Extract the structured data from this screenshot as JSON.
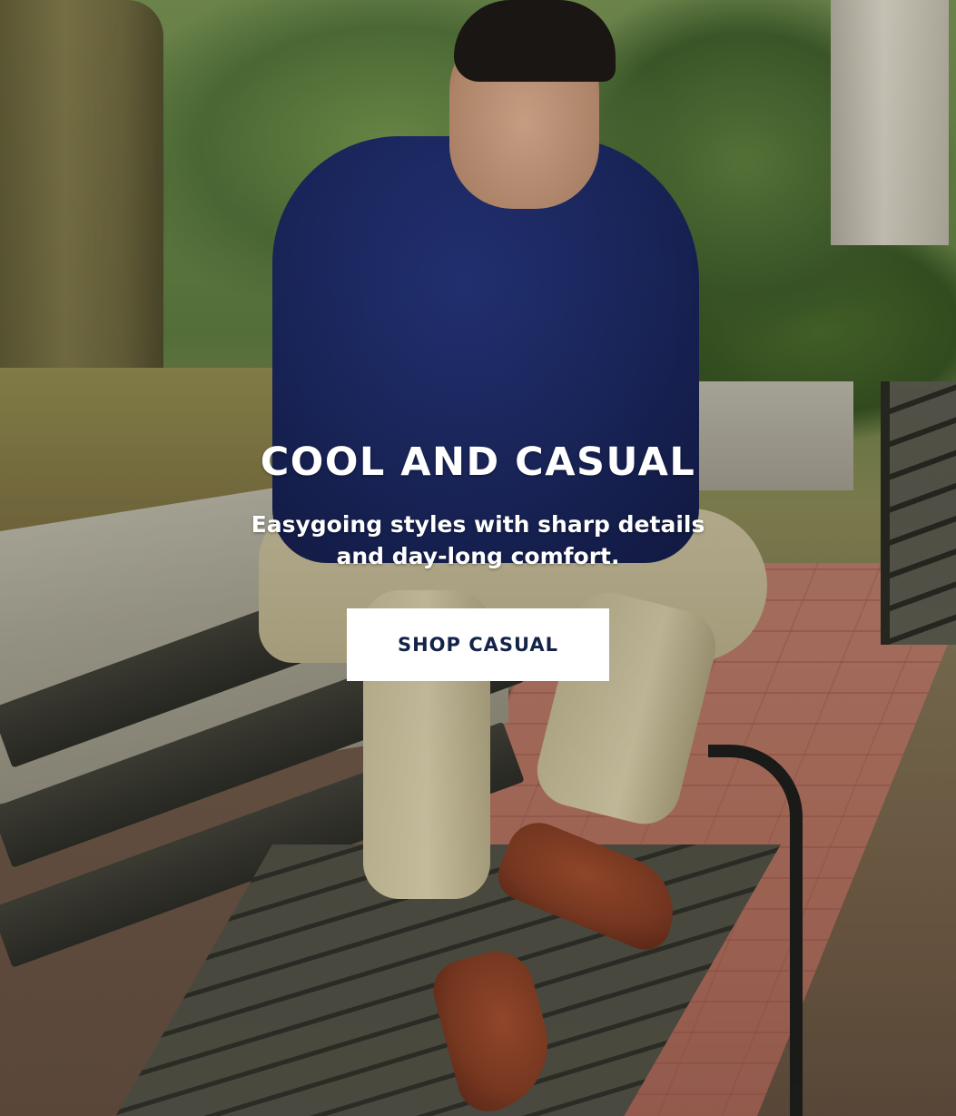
{
  "hero": {
    "headline": "COOL AND CASUAL",
    "subheadline": "Easygoing styles with sharp details and day-long comfort.",
    "cta_label": "SHOP CASUAL",
    "image_subject": "man-in-navy-shirt-khakis-brown-loafers-seated-on-park-bench",
    "colors": {
      "text": "#ffffff",
      "button_bg": "#ffffff",
      "button_text": "#14234a"
    }
  }
}
